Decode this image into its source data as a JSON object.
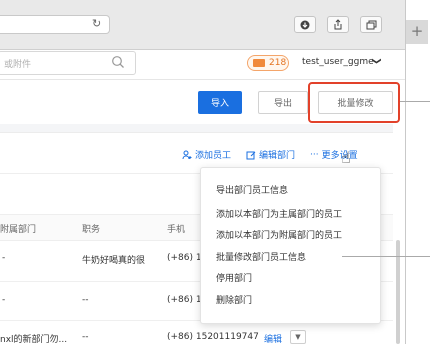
{
  "browser": {
    "search_suffix": "或附件",
    "toolbar_icons": [
      "download-icon",
      "share-icon",
      "tabs-icon"
    ],
    "new_tab_symbol": "+"
  },
  "header": {
    "mail_count": "218",
    "user_name": "test_user_ggme",
    "user_chevron": "❯"
  },
  "actions": {
    "import_label": "导入",
    "export_label": "导出",
    "batch_edit_label": "批量修改"
  },
  "panel_links": {
    "add_employee": "添加员工",
    "edit_department": "编辑部门",
    "more_settings": "更多设置"
  },
  "table": {
    "headers": [
      "附属部门",
      "职务",
      "手机"
    ],
    "rows": [
      {
        "dept": "-",
        "title": "牛奶好喝真的很",
        "phone": "(+86) 19"
      },
      {
        "dept": "-",
        "title": "--",
        "phone": "(+86) 13"
      },
      {
        "dept": "nxl的新部门勿...",
        "title": "--",
        "phone": "(+86) 15201119747",
        "edit": "编辑"
      }
    ]
  },
  "dropdown_menu": {
    "items": [
      "导出部门员工信息",
      "添加以本部门为主属部门的员工",
      "添加以本部门为附属部门的员工",
      "批量修改部门员工信息",
      "停用部门",
      "删除部门"
    ]
  },
  "colors": {
    "primary": "#1a6fe0",
    "highlight": "#e2412a",
    "badge": "#f08a3c"
  }
}
